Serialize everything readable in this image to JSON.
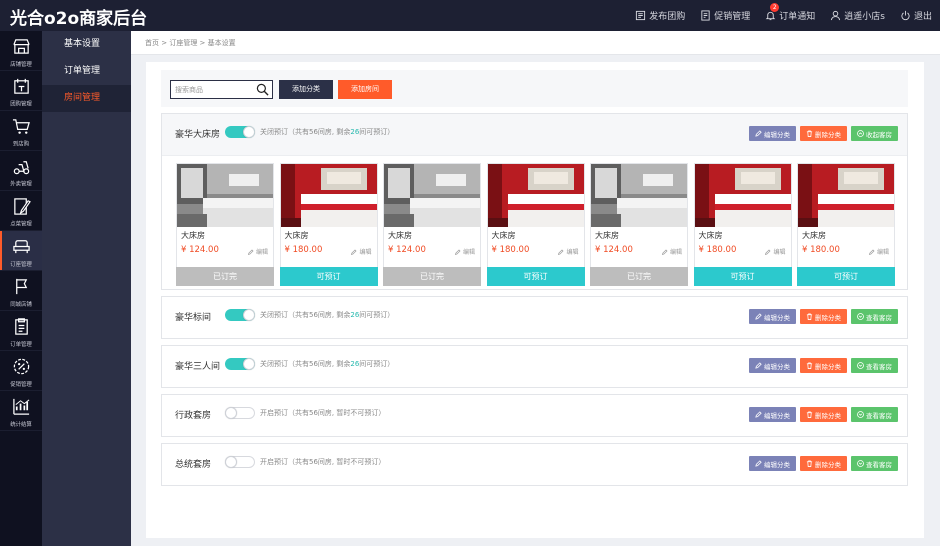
{
  "app": {
    "logo": "光合o2o商家后台"
  },
  "header_nav": [
    {
      "label": "发布团购",
      "icon": "publish-icon"
    },
    {
      "label": "促销管理",
      "icon": "promo-icon"
    },
    {
      "label": "订单通知",
      "icon": "bell-icon",
      "badge": "2"
    },
    {
      "label": "逍遥小店s",
      "icon": "user-icon"
    },
    {
      "label": "退出",
      "icon": "power-icon"
    }
  ],
  "rail": [
    {
      "label": "店铺管理",
      "icon": "store-icon"
    },
    {
      "label": "团购管理",
      "icon": "group-buy-icon"
    },
    {
      "label": "到店购",
      "icon": "cart-icon"
    },
    {
      "label": "外卖管理",
      "icon": "delivery-icon"
    },
    {
      "label": "点菜管理",
      "icon": "menu-order-icon"
    },
    {
      "label": "订座管理",
      "icon": "seat-icon",
      "active": true
    },
    {
      "label": "同城店铺",
      "icon": "flag-icon"
    },
    {
      "label": "订单管理",
      "icon": "order-icon"
    },
    {
      "label": "促销管理",
      "icon": "discount-icon"
    },
    {
      "label": "统计结算",
      "icon": "stats-icon"
    }
  ],
  "submenu": [
    {
      "label": "基本设置"
    },
    {
      "label": "订单管理"
    },
    {
      "label": "房间管理",
      "active": true
    }
  ],
  "breadcrumb": "首页 > 订座管理 > 基本设置",
  "toolbar": {
    "search_placeholder": "搜索商品",
    "add_category_label": "添加分类",
    "add_room_label": "添加房间"
  },
  "actions": {
    "edit_label": "编辑分类",
    "delete_label": "删除分类",
    "collapse_label": "收起客房",
    "view_label": "查看客房"
  },
  "categories": [
    {
      "name": "豪华大床房",
      "on": true,
      "expanded": true,
      "status_pre": "关闭预订（共有56间房, 剩余",
      "status_num": "26",
      "status_post": "间可预订）"
    },
    {
      "name": "豪华标间",
      "on": true,
      "expanded": false,
      "status_pre": "关闭预订（共有56间房, 剩余",
      "status_num": "26",
      "status_post": "间可预订）"
    },
    {
      "name": "豪华三人间",
      "on": true,
      "expanded": false,
      "status_pre": "关闭预订（共有56间房, 剩余",
      "status_num": "26",
      "status_post": "间可预订）"
    },
    {
      "name": "行政套房",
      "on": false,
      "expanded": false,
      "status_pre": "开启预订（共有56间房, 暂时不可预订）",
      "status_num": "",
      "status_post": ""
    },
    {
      "name": "总统套房",
      "on": false,
      "expanded": false,
      "status_pre": "开启预订（共有56间房, 暂时不可预订）",
      "status_num": "",
      "status_post": ""
    }
  ],
  "rooms": [
    {
      "name": "大床房",
      "price": "¥ 124.00",
      "edit": "编辑",
      "status": "已订完",
      "booked": true,
      "photo": "gray-room"
    },
    {
      "name": "大床房",
      "price": "¥ 180.00",
      "edit": "编辑",
      "status": "可预订",
      "booked": false,
      "photo": "red-room"
    },
    {
      "name": "大床房",
      "price": "¥ 124.00",
      "edit": "编辑",
      "status": "已订完",
      "booked": true,
      "photo": "gray-room"
    },
    {
      "name": "大床房",
      "price": "¥ 180.00",
      "edit": "编辑",
      "status": "可预订",
      "booked": false,
      "photo": "red-room"
    },
    {
      "name": "大床房",
      "price": "¥ 124.00",
      "edit": "编辑",
      "status": "已订完",
      "booked": true,
      "photo": "gray-room"
    },
    {
      "name": "大床房",
      "price": "¥ 180.00",
      "edit": "编辑",
      "status": "可预订",
      "booked": false,
      "photo": "red-room"
    },
    {
      "name": "大床房",
      "price": "¥ 180.00",
      "edit": "编辑",
      "status": "可预订",
      "booked": false,
      "photo": "red-room"
    }
  ],
  "colors": {
    "header_bg": "#1d2033",
    "accent_orange": "#ff5b2a",
    "toggle_on": "#34c9c1",
    "available": "#2cc9cd",
    "booked": "#bdbdbd",
    "edit_btn": "#7b82b7",
    "delete_btn": "#ff6a3c",
    "view_btn": "#5bc46c"
  }
}
